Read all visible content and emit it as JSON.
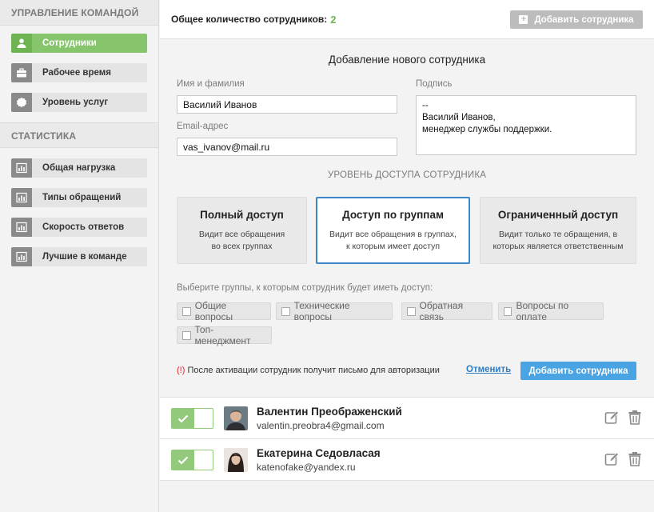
{
  "sidebar": {
    "team_header": "Управление командой",
    "team_items": [
      {
        "label": "Сотрудники",
        "icon": "user-icon"
      },
      {
        "label": "Рабочее время",
        "icon": "briefcase-icon"
      },
      {
        "label": "Уровень услуг",
        "icon": "badge-icon"
      }
    ],
    "stats_header": "Статистика",
    "stats_items": [
      {
        "label": "Общая нагрузка",
        "icon": "bar-chart-icon"
      },
      {
        "label": "Типы обращений",
        "icon": "bar-chart-icon"
      },
      {
        "label": "Скорость ответов",
        "icon": "bar-chart-icon"
      },
      {
        "label": "Лучшие в команде",
        "icon": "bar-chart-icon"
      }
    ]
  },
  "topbar": {
    "total_label": "Общее количество сотрудников:",
    "total_count": "2",
    "add_button": "Добавить сотрудника"
  },
  "form": {
    "title": "Добавление нового сотрудника",
    "name_label": "Имя и фамилия",
    "name_value": "Василий Иванов",
    "email_label": "Email-адрес",
    "email_value": "vas_ivanov@mail.ru",
    "signature_label": "Подпись",
    "signature_lines": [
      "--",
      "Василий Иванов,",
      "менеджер службы поддержки."
    ],
    "access_title": "Уровень доступа сотрудника",
    "access_levels": [
      {
        "title": "Полный доступ",
        "desc": [
          "Видит все обращения",
          "во всех группах"
        ],
        "selected": false
      },
      {
        "title": "Доступ по группам",
        "desc": [
          "Видит все обращения в группах,",
          "к которым имеет доступ"
        ],
        "selected": true
      },
      {
        "title": "Ограниченный доступ",
        "desc": [
          "Видит только те обращения, в",
          "которых является ответственным"
        ],
        "selected": false
      }
    ],
    "groups_label": "Выберите группы, к которым сотрудник будет иметь доступ:",
    "groups": [
      "Общие вопросы",
      "Технические вопросы",
      "Обратная связь",
      "Вопросы по оплате",
      "Топ-менеджмент"
    ],
    "warning_mark": "(!)",
    "warning_text": "После активации сотрудник получит письмо для авторизации",
    "cancel_label": "Отменить",
    "submit_label": "Добавить сотрудника"
  },
  "employees": [
    {
      "name": "Валентин Преображенский",
      "email": "valentin.preobra4@gmail.com",
      "active": true
    },
    {
      "name": "Екатерина Седовласая",
      "email": "katenofake@yandex.ru",
      "active": true
    }
  ],
  "colors": {
    "accent_green": "#86c56c",
    "accent_blue": "#4aa3e3",
    "selected_border": "#3b86c6",
    "warning": "#dd2233"
  }
}
